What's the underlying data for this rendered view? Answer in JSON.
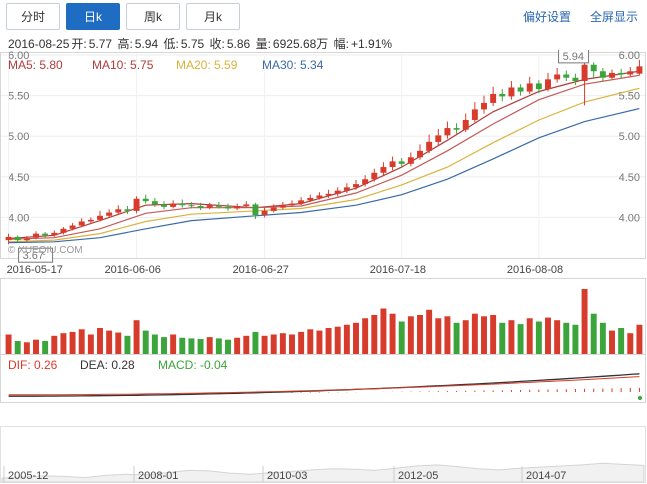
{
  "tabs": [
    {
      "label": "分时",
      "active": false
    },
    {
      "label": "日k",
      "active": true
    },
    {
      "label": "周k",
      "active": false
    },
    {
      "label": "月k",
      "active": false
    }
  ],
  "links": {
    "settings": "偏好设置",
    "fullscreen": "全屏显示"
  },
  "quote": {
    "date": "2016-08-25",
    "open_label": "开:",
    "open": "5.77",
    "high_label": "高:",
    "high": "5.94",
    "low_label": "低:",
    "low": "5.75",
    "close_label": "收:",
    "close": "5.86",
    "volume_label": "量:",
    "volume": "6925.68万",
    "change_label": "幅:",
    "change": "+1.91%"
  },
  "colors": {
    "up": "#d63b2b",
    "down": "#3ba53b",
    "ma5": "#b23b3b",
    "ma10": "#b23b3b",
    "ma20": "#d9b340",
    "ma30": "#3a6aa8",
    "accent": "#1f6dc2"
  },
  "watermark": "© XUEQIU.COM",
  "chart_data": {
    "type": "candlestick",
    "ma_legend": [
      {
        "name": "MA5",
        "value": "5.80"
      },
      {
        "name": "MA10",
        "value": "5.75"
      },
      {
        "name": "MA20",
        "value": "5.59"
      },
      {
        "name": "MA30",
        "value": "5.34"
      }
    ],
    "price_ticks": [
      "6.00",
      "5.50",
      "5.00",
      "4.50",
      "4.00"
    ],
    "price_range": [
      3.5,
      6.0
    ],
    "x_dates": [
      {
        "label": "2016-05-17",
        "index": 0
      },
      {
        "label": "2016-06-06",
        "index": 14
      },
      {
        "label": "2016-06-27",
        "index": 28
      },
      {
        "label": "2016-07-18",
        "index": 43
      },
      {
        "label": "2016-08-08",
        "index": 58
      }
    ],
    "max_marker": "5.94",
    "min_marker": "3.67",
    "candles": [
      [
        3.72,
        3.76,
        3.8,
        3.67
      ],
      [
        3.76,
        3.72,
        3.78,
        3.7
      ],
      [
        3.72,
        3.74,
        3.77,
        3.7
      ],
      [
        3.75,
        3.8,
        3.83,
        3.73
      ],
      [
        3.8,
        3.78,
        3.82,
        3.75
      ],
      [
        3.78,
        3.81,
        3.84,
        3.76
      ],
      [
        3.81,
        3.86,
        3.88,
        3.79
      ],
      [
        3.86,
        3.9,
        3.93,
        3.84
      ],
      [
        3.9,
        3.95,
        3.99,
        3.88
      ],
      [
        3.95,
        3.97,
        4.0,
        3.92
      ],
      [
        3.97,
        4.02,
        4.08,
        3.95
      ],
      [
        4.02,
        4.06,
        4.1,
        4.0
      ],
      [
        4.06,
        4.1,
        4.15,
        4.03
      ],
      [
        4.1,
        4.08,
        4.14,
        4.04
      ],
      [
        4.08,
        4.23,
        4.26,
        4.05
      ],
      [
        4.23,
        4.2,
        4.28,
        4.17
      ],
      [
        4.2,
        4.16,
        4.24,
        4.13
      ],
      [
        4.16,
        4.13,
        4.2,
        4.1
      ],
      [
        4.13,
        4.17,
        4.21,
        4.11
      ],
      [
        4.17,
        4.15,
        4.22,
        4.12
      ],
      [
        4.15,
        4.14,
        4.19,
        4.11
      ],
      [
        4.14,
        4.12,
        4.18,
        4.09
      ],
      [
        4.12,
        4.15,
        4.18,
        4.1
      ],
      [
        4.15,
        4.13,
        4.19,
        4.11
      ],
      [
        4.13,
        4.11,
        4.17,
        4.08
      ],
      [
        4.11,
        4.14,
        4.17,
        4.09
      ],
      [
        4.14,
        4.16,
        4.2,
        4.12
      ],
      [
        4.16,
        4.03,
        4.18,
        3.98
      ],
      [
        4.03,
        4.08,
        4.12,
        4.0
      ],
      [
        4.08,
        4.12,
        4.16,
        4.06
      ],
      [
        4.12,
        4.15,
        4.19,
        4.1
      ],
      [
        4.15,
        4.17,
        4.21,
        4.13
      ],
      [
        4.17,
        4.21,
        4.25,
        4.15
      ],
      [
        4.21,
        4.24,
        4.28,
        4.19
      ],
      [
        4.24,
        4.27,
        4.31,
        4.22
      ],
      [
        4.27,
        4.29,
        4.34,
        4.24
      ],
      [
        4.29,
        4.33,
        4.37,
        4.26
      ],
      [
        4.33,
        4.37,
        4.42,
        4.3
      ],
      [
        4.37,
        4.41,
        4.46,
        4.34
      ],
      [
        4.41,
        4.47,
        4.52,
        4.38
      ],
      [
        4.47,
        4.55,
        4.6,
        4.44
      ],
      [
        4.55,
        4.62,
        4.68,
        4.51
      ],
      [
        4.62,
        4.69,
        4.75,
        4.58
      ],
      [
        4.69,
        4.66,
        4.73,
        4.62
      ],
      [
        4.66,
        4.74,
        4.8,
        4.63
      ],
      [
        4.74,
        4.82,
        4.9,
        4.71
      ],
      [
        4.82,
        4.93,
        5.02,
        4.79
      ],
      [
        4.93,
        5.01,
        5.09,
        4.88
      ],
      [
        5.01,
        5.1,
        5.18,
        4.97
      ],
      [
        5.1,
        5.08,
        5.16,
        5.03
      ],
      [
        5.08,
        5.2,
        5.28,
        5.05
      ],
      [
        5.2,
        5.33,
        5.42,
        5.17
      ],
      [
        5.33,
        5.41,
        5.5,
        5.28
      ],
      [
        5.41,
        5.52,
        5.61,
        5.37
      ],
      [
        5.52,
        5.49,
        5.58,
        5.43
      ],
      [
        5.49,
        5.6,
        5.68,
        5.45
      ],
      [
        5.6,
        5.55,
        5.64,
        5.5
      ],
      [
        5.55,
        5.65,
        5.73,
        5.52
      ],
      [
        5.65,
        5.58,
        5.69,
        5.53
      ],
      [
        5.58,
        5.7,
        5.78,
        5.55
      ],
      [
        5.7,
        5.76,
        5.84,
        5.66
      ],
      [
        5.76,
        5.72,
        5.81,
        5.68
      ],
      [
        5.72,
        5.68,
        5.77,
        5.63
      ],
      [
        5.68,
        5.88,
        5.94,
        5.38
      ],
      [
        5.88,
        5.8,
        5.91,
        5.72
      ],
      [
        5.8,
        5.72,
        5.84,
        5.67
      ],
      [
        5.72,
        5.78,
        5.82,
        5.7
      ],
      [
        5.78,
        5.76,
        5.83,
        5.71
      ],
      [
        5.76,
        5.8,
        5.85,
        5.73
      ],
      [
        5.77,
        5.86,
        5.94,
        5.75
      ]
    ],
    "ma": {
      "MA5": [
        [
          0,
          3.74
        ],
        [
          5,
          3.78
        ],
        [
          10,
          3.96
        ],
        [
          15,
          4.15
        ],
        [
          20,
          4.17
        ],
        [
          27,
          4.12
        ],
        [
          32,
          4.17
        ],
        [
          38,
          4.36
        ],
        [
          43,
          4.62
        ],
        [
          48,
          4.95
        ],
        [
          53,
          5.3
        ],
        [
          58,
          5.55
        ],
        [
          63,
          5.7
        ],
        [
          69,
          5.8
        ]
      ],
      "MA10": [
        [
          0,
          3.73
        ],
        [
          5,
          3.75
        ],
        [
          10,
          3.86
        ],
        [
          15,
          4.05
        ],
        [
          20,
          4.12
        ],
        [
          27,
          4.12
        ],
        [
          32,
          4.14
        ],
        [
          38,
          4.3
        ],
        [
          43,
          4.52
        ],
        [
          48,
          4.82
        ],
        [
          53,
          5.15
        ],
        [
          58,
          5.45
        ],
        [
          63,
          5.64
        ],
        [
          69,
          5.75
        ]
      ],
      "MA20": [
        [
          0,
          3.7
        ],
        [
          5,
          3.72
        ],
        [
          10,
          3.8
        ],
        [
          15,
          3.95
        ],
        [
          20,
          4.04
        ],
        [
          27,
          4.08
        ],
        [
          32,
          4.11
        ],
        [
          38,
          4.22
        ],
        [
          43,
          4.4
        ],
        [
          48,
          4.62
        ],
        [
          53,
          4.92
        ],
        [
          58,
          5.2
        ],
        [
          63,
          5.42
        ],
        [
          69,
          5.59
        ]
      ],
      "MA30": [
        [
          0,
          3.69
        ],
        [
          5,
          3.7
        ],
        [
          10,
          3.75
        ],
        [
          15,
          3.86
        ],
        [
          20,
          3.96
        ],
        [
          27,
          4.02
        ],
        [
          32,
          4.06
        ],
        [
          38,
          4.15
        ],
        [
          43,
          4.28
        ],
        [
          48,
          4.47
        ],
        [
          53,
          4.72
        ],
        [
          58,
          4.98
        ],
        [
          63,
          5.18
        ],
        [
          69,
          5.34
        ]
      ]
    },
    "volumes": [
      0.3,
      0.2,
      0.18,
      0.22,
      0.2,
      0.28,
      0.32,
      0.34,
      0.38,
      0.3,
      0.4,
      0.36,
      0.33,
      0.28,
      0.52,
      0.36,
      0.3,
      0.26,
      0.3,
      0.25,
      0.24,
      0.23,
      0.26,
      0.24,
      0.22,
      0.25,
      0.28,
      0.34,
      0.28,
      0.3,
      0.32,
      0.3,
      0.34,
      0.38,
      0.36,
      0.4,
      0.42,
      0.45,
      0.48,
      0.55,
      0.6,
      0.7,
      0.62,
      0.5,
      0.58,
      0.6,
      0.68,
      0.55,
      0.58,
      0.48,
      0.52,
      0.62,
      0.58,
      0.6,
      0.48,
      0.52,
      0.46,
      0.55,
      0.5,
      0.56,
      0.52,
      0.48,
      0.45,
      1.0,
      0.62,
      0.48,
      0.36,
      0.4,
      0.32,
      0.45
    ],
    "macd_legend": [
      {
        "name": "DIF",
        "value": "0.26"
      },
      {
        "name": "DEA",
        "value": "0.28"
      },
      {
        "name": "MACD",
        "value": "-0.04"
      }
    ],
    "overview_dates": [
      "2005-12",
      "2008-01",
      "2010-03",
      "2012-05",
      "2014-07"
    ]
  }
}
